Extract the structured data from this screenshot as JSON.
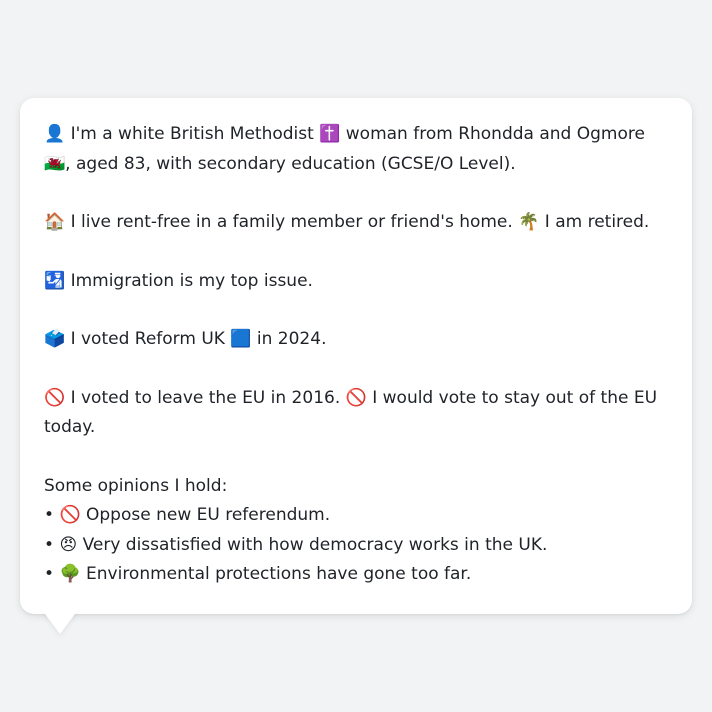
{
  "profile": {
    "identity_icon": "👤",
    "identity_text_1": " I'm a white British Methodist ",
    "religion_icon": "✝️",
    "identity_text_2": " woman from Rhondda and Ogmore ",
    "flag_icon": "🏴󠁧󠁢󠁷󠁬󠁳󠁿",
    "identity_text_3": ", aged 83, with secondary education (GCSE/O Level).",
    "housing_icon": "🏠",
    "housing_text": " I live rent-free in a family member or friend's home. ",
    "retired_icon": "🌴",
    "retired_text": " I am retired.",
    "issue_icon": "🛂",
    "issue_text": " Immigration is my top issue.",
    "vote_icon": "🗳️",
    "vote_text_1": " I voted Reform UK ",
    "party_icon": "🟦",
    "vote_text_2": " in 2024.",
    "eu_icon_1": "🚫",
    "eu_text_1": " I voted to leave the EU in 2016. ",
    "eu_icon_2": "🚫",
    "eu_text_2": " I would vote to stay out of the EU today."
  },
  "opinions": {
    "heading": "Some opinions I hold:",
    "bullet": "• ",
    "items": [
      {
        "icon": "🚫",
        "text": " Oppose new EU referendum."
      },
      {
        "icon": "😠",
        "text": " Very dissatisfied with how democracy works in the UK."
      },
      {
        "icon": "🌳",
        "text": " Environmental protections have gone too far."
      }
    ]
  }
}
